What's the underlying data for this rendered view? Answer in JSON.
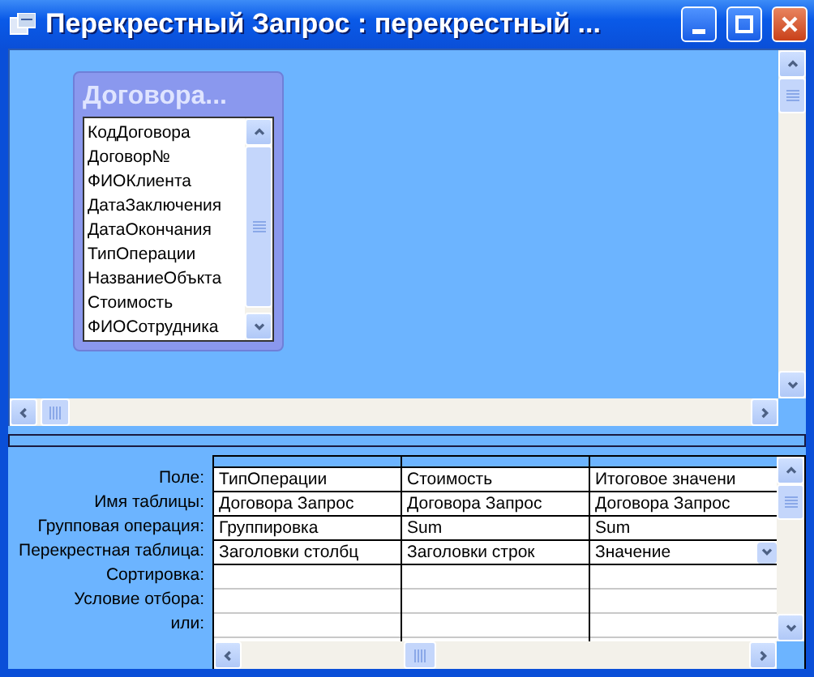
{
  "window": {
    "title": "Перекрестный Запрос : перекрестный ..."
  },
  "field_list": {
    "title": "Договора...",
    "fields": [
      "КодДоговора",
      "Договор№",
      "ФИОКлиента",
      "ДатаЗаключения",
      "ДатаОкончания",
      "ТипОперации",
      "НазваниеОбъкта",
      "Стоимость",
      "ФИОСотрудника"
    ]
  },
  "grid": {
    "row_labels": [
      "Поле:",
      "Имя таблицы:",
      "Групповая операция:",
      "Перекрестная таблица:",
      "Сортировка:",
      "Условие отбора:",
      "или:"
    ],
    "columns": [
      {
        "cells": [
          {
            "text": "ТипОперации",
            "kind": "text"
          },
          {
            "text": "Договора Запрос",
            "kind": "text"
          },
          {
            "text": "Группировка",
            "kind": "text"
          },
          {
            "text": "Заголовки столбц",
            "kind": "text"
          }
        ]
      },
      {
        "cells": [
          {
            "text": "Стоимость",
            "kind": "text"
          },
          {
            "text": "Договора Запрос",
            "kind": "text"
          },
          {
            "text": "Sum",
            "kind": "text"
          },
          {
            "text": "Заголовки строк",
            "kind": "text"
          }
        ]
      },
      {
        "cells": [
          {
            "text": "Итоговое значени",
            "kind": "text"
          },
          {
            "text": "Договора Запрос",
            "kind": "text"
          },
          {
            "text": "Sum",
            "kind": "text"
          },
          {
            "text": "Значение",
            "kind": "dropdown"
          }
        ]
      }
    ]
  }
}
